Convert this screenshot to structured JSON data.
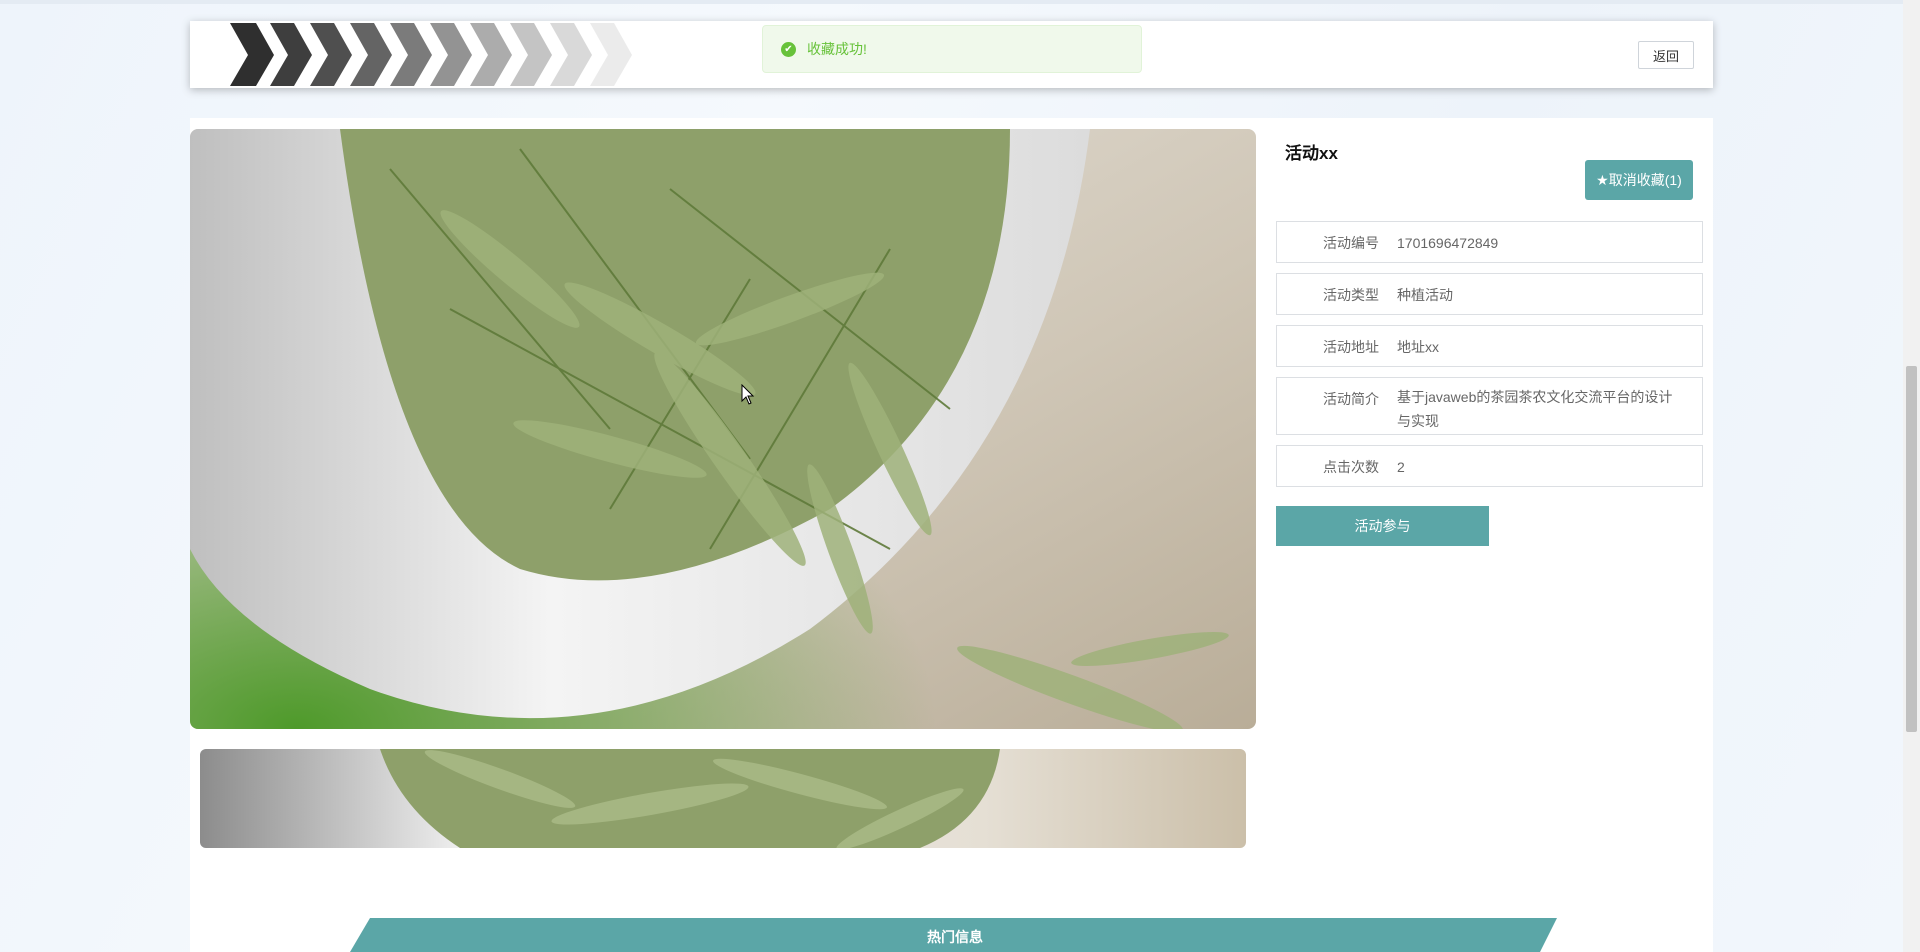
{
  "header": {
    "back_label": "返回"
  },
  "toast": {
    "message": "收藏成功!",
    "icon": "check-circle-icon",
    "color": "#67c23a"
  },
  "detail": {
    "title": "活动xx",
    "favorite_button": "★取消收藏(1)",
    "fields": [
      {
        "label": "活动编号",
        "value": "1701696472849"
      },
      {
        "label": "活动类型",
        "value": "种植活动"
      },
      {
        "label": "活动地址",
        "value": "地址xx"
      },
      {
        "label": "活动简介",
        "value": "基于javaweb的茶园茶农文化交流平台的设计与实现"
      },
      {
        "label": "点击次数",
        "value": "2"
      }
    ],
    "join_button": "活动参与"
  },
  "hot_section": {
    "title": "热门信息"
  },
  "theme": {
    "accent": "#5ba6a7",
    "success": "#67c23a"
  }
}
